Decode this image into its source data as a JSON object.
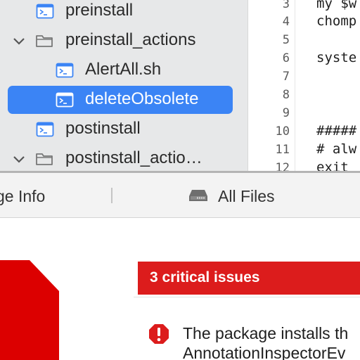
{
  "tree": {
    "items": [
      {
        "label": "preinstall",
        "icon": "script-icon",
        "kind": "file"
      },
      {
        "label": "preinstall_actions",
        "icon": "folder-icon",
        "kind": "folder",
        "expanded": true
      },
      {
        "label": "AlertAll.sh",
        "icon": "script-icon",
        "kind": "file"
      },
      {
        "label": "deleteObsolete",
        "icon": "script-icon",
        "kind": "file",
        "selected": true
      },
      {
        "label": "postinstall",
        "icon": "script-icon",
        "kind": "file"
      },
      {
        "label": "postinstall_actio…",
        "icon": "folder-icon",
        "kind": "folder",
        "expanded": true
      }
    ]
  },
  "editor": {
    "line_numbers": [
      "3",
      "4",
      "5",
      "6",
      "7",
      "8",
      "9",
      "10",
      "11",
      "12"
    ],
    "lines": [
      "my $w",
      "chomp",
      "",
      "syste",
      "",
      "",
      "",
      "#####",
      "# alw",
      "exit "
    ]
  },
  "tabs": {
    "left_label": "ge Info",
    "all_files_label": "All Files"
  },
  "report": {
    "critical_label": "3 critical issues",
    "issue_line1": "The package installs th",
    "issue_line2": "AnnotationInspectorEv"
  },
  "colors": {
    "selection": "#3b84f5",
    "critical": "#dc1c1c",
    "icon_blue": "#3b84f5"
  }
}
